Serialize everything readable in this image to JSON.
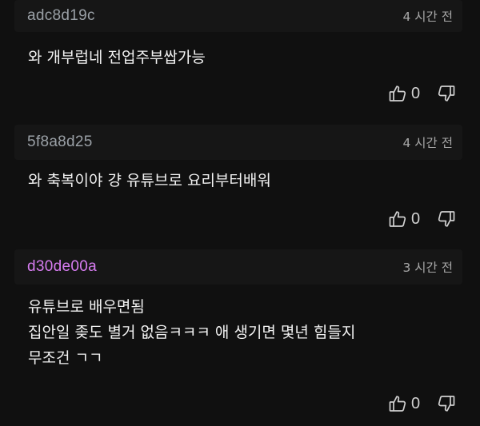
{
  "comments": [
    {
      "username": "adc8d19c",
      "username_color": "#9aa0a6",
      "time": "4 시간 전",
      "lines": [
        "와 개부럽네 전업주부쌉가능"
      ],
      "likes": "0",
      "like_icon": "thumbs-up-icon",
      "dislike_icon": "thumbs-down-icon"
    },
    {
      "username": "5f8a8d25",
      "username_color": "#9aa0a6",
      "time": "4 시간 전",
      "lines": [
        "와 축복이야 걍 유튜브로 요리부터배워"
      ],
      "likes": "0",
      "like_icon": "thumbs-up-icon",
      "dislike_icon": "thumbs-down-icon"
    },
    {
      "username": "d30de00a",
      "username_color": "#d67cf0",
      "time": "3 시간 전",
      "lines": [
        "유튜브로 배우면됨",
        "집안일 좆도 별거 없음ㅋㅋㅋ 애 생기면 몇년 힘들지",
        "무조건 ㄱㄱ"
      ],
      "likes": "0",
      "like_icon": "thumbs-up-icon",
      "dislike_icon": "thumbs-down-icon"
    }
  ]
}
